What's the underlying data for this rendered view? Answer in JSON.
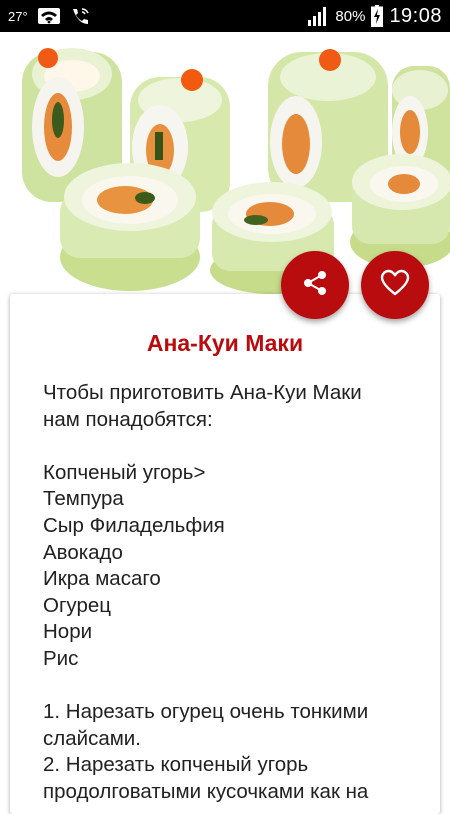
{
  "status_bar": {
    "temperature": "27°",
    "battery": "80%",
    "time": "19:08"
  },
  "recipe": {
    "title": "Ана-Куи Маки",
    "intro": [
      "Чтобы приготовить Ана-Куи Маки",
      "нам понадобятся:"
    ],
    "ingredients": [
      "Копченый угорь>",
      "Темпура",
      "Сыр Филадельфия",
      "Авокадо",
      "Икра масаго",
      "Огурец",
      "Нори",
      "Рис"
    ],
    "steps": [
      "1. Нарезать огурец очень тонкими",
      "слайсами.",
      "2. Нарезать копченый угорь",
      "продолговатыми кусочками как на"
    ]
  },
  "icons": {
    "share": "share-icon",
    "favorite": "heart-icon"
  },
  "colors": {
    "accent": "#b80c0f",
    "status_bar": "#000000"
  }
}
